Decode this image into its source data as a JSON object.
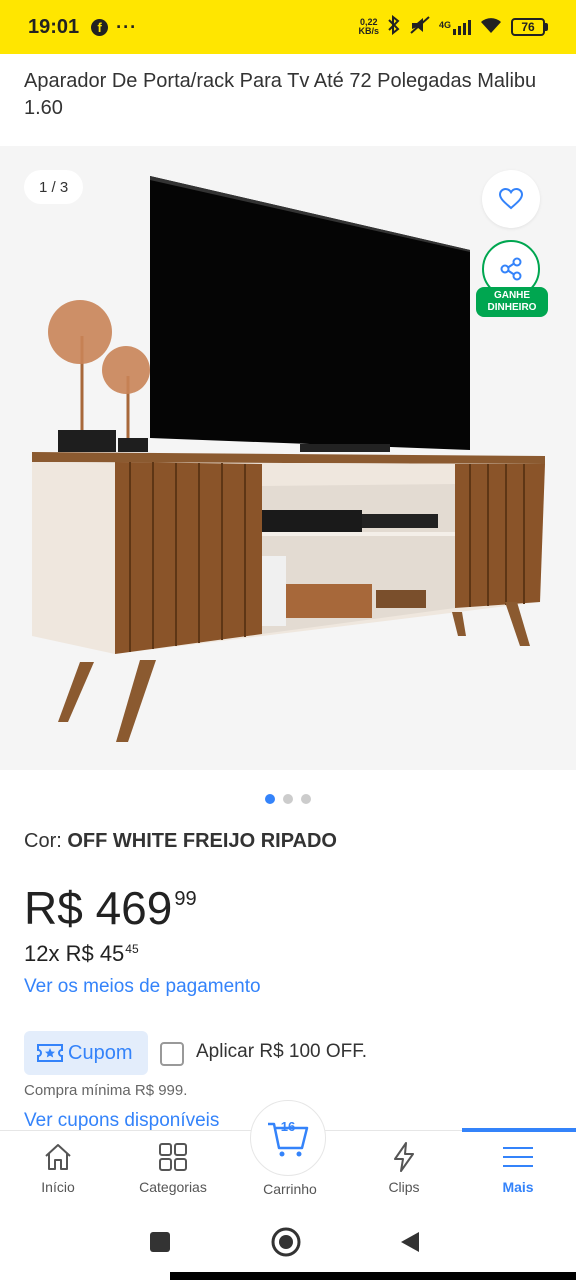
{
  "status_bar": {
    "time": "19:01",
    "more": "···",
    "net_speed_value": "0,22",
    "net_speed_unit": "KB/s",
    "network": "4G",
    "battery": "76"
  },
  "product": {
    "title": "Aparador De Porta/rack Para Tv Até 72 Polegadas Malibu 1.60",
    "image_counter": "1 / 3",
    "earn_badge_line1": "GANHE",
    "earn_badge_line2": "DINHEIRO",
    "image_dots": {
      "total": 3,
      "active": 1
    },
    "color_label": "Cor:",
    "color_value": "OFF WHITE FREIJO RIPADO",
    "price_main": "R$ 469",
    "price_cents": "99",
    "installments_main": "12x R$ 45",
    "installments_cents": "45",
    "payment_link": "Ver os meios de pagamento"
  },
  "coupon": {
    "label": "Cupom",
    "apply_text": "Aplicar R$ 100 OFF.",
    "checked": false,
    "min_purchase": "Compra mínima R$ 999.",
    "see_coupons": "Ver cupons disponíveis"
  },
  "bottom_nav": {
    "items": [
      {
        "label": "Início",
        "icon": "home-icon"
      },
      {
        "label": "Categorias",
        "icon": "grid-icon"
      },
      {
        "label": "Carrinho",
        "icon": "cart-icon",
        "count": "16"
      },
      {
        "label": "Clips",
        "icon": "lightning-icon"
      },
      {
        "label": "Mais",
        "icon": "menu-icon",
        "active": true
      }
    ]
  },
  "colors": {
    "status_bar": "#FFE600",
    "accent_blue": "#3483FA",
    "earn_green": "#00A650",
    "coupon_bg": "#E3EDFB"
  }
}
